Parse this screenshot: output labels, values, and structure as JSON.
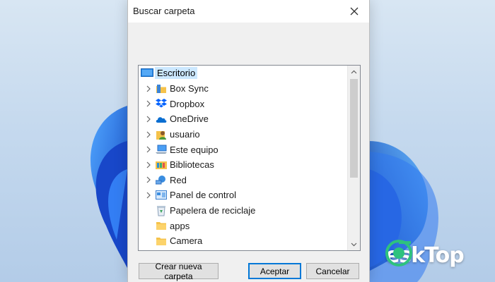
{
  "dialog": {
    "title": "Buscar carpeta",
    "close_icon": "close-icon"
  },
  "tree": {
    "root": {
      "label": "Escritorio",
      "icon": "desktop-icon",
      "selected": true
    },
    "items": [
      {
        "label": "Box Sync",
        "icon": "box-sync-folder-icon",
        "expandable": true
      },
      {
        "label": "Dropbox",
        "icon": "dropbox-icon",
        "expandable": true
      },
      {
        "label": "OneDrive",
        "icon": "onedrive-icon",
        "expandable": true
      },
      {
        "label": "usuario",
        "icon": "user-folder-icon",
        "expandable": true
      },
      {
        "label": "Este equipo",
        "icon": "computer-icon",
        "expandable": true
      },
      {
        "label": "Bibliotecas",
        "icon": "libraries-icon",
        "expandable": true
      },
      {
        "label": "Red",
        "icon": "network-icon",
        "expandable": true
      },
      {
        "label": "Panel de control",
        "icon": "control-panel-icon",
        "expandable": true
      },
      {
        "label": "Papelera de reciclaje",
        "icon": "recycle-bin-icon",
        "expandable": false
      },
      {
        "label": "apps",
        "icon": "folder-icon",
        "expandable": false
      },
      {
        "label": "Camera",
        "icon": "folder-icon",
        "expandable": false
      }
    ]
  },
  "buttons": {
    "new_folder": "Crear nueva carpeta",
    "accept": "Aceptar",
    "cancel": "Cancelar"
  },
  "watermark": {
    "text": "eskTop",
    "logo_icon": "desktop-logo-icon"
  },
  "colors": {
    "selection": "#cce8ff",
    "accent": "#0078d7",
    "wallpaper_blue": "#1a5fd6"
  }
}
